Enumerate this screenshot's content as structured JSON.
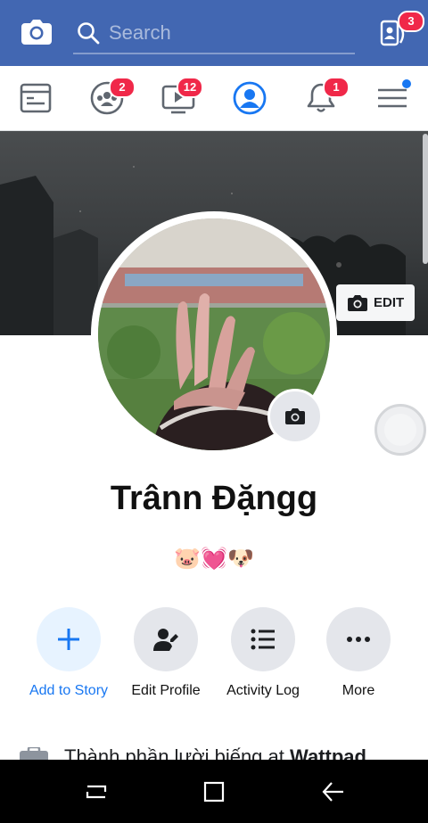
{
  "topbar": {
    "camera_icon": "camera-icon",
    "search_icon": "search-icon",
    "search_placeholder": "Search",
    "contacts_icon": "contacts-icon",
    "contacts_badge": "3"
  },
  "nav": {
    "items": [
      {
        "icon": "news-feed-icon",
        "badge": ""
      },
      {
        "icon": "groups-icon",
        "badge": "2"
      },
      {
        "icon": "watch-icon",
        "badge": "12"
      },
      {
        "icon": "profile-icon",
        "badge": ""
      },
      {
        "icon": "notifications-icon",
        "badge": "1"
      },
      {
        "icon": "menu-icon",
        "badge": ""
      }
    ]
  },
  "profile": {
    "name": "Trânn Đặngg",
    "bio": "🐷💓🐶",
    "edit_cover_label": "EDIT"
  },
  "actions": [
    {
      "label": "Add to Story",
      "icon": "plus-icon"
    },
    {
      "label": "Edit Profile",
      "icon": "edit-profile-icon"
    },
    {
      "label": "Activity Log",
      "icon": "list-icon"
    },
    {
      "label": "More",
      "icon": "more-icon"
    }
  ],
  "info": {
    "prefix": "Thành phần lười biếng at ",
    "org": "Wattpad"
  },
  "colors": {
    "brand": "#4267b2",
    "badge": "#f02849",
    "accent": "#1877f2"
  }
}
